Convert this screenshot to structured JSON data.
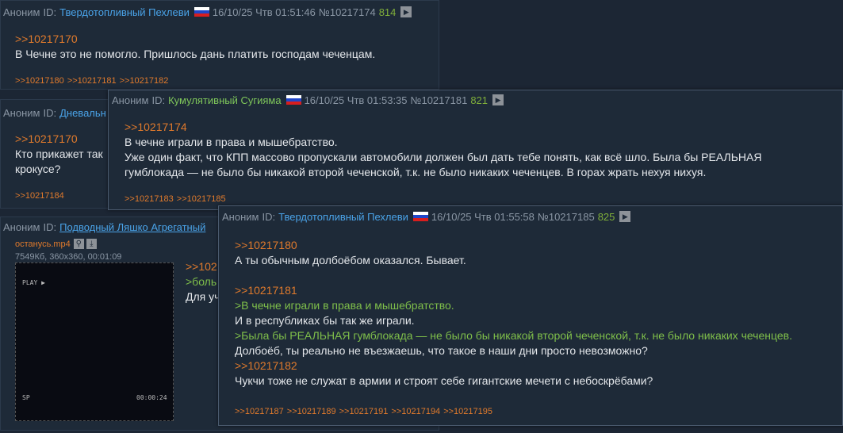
{
  "post1": {
    "name": "Аноним",
    "id_label": "ID:",
    "poster_id": "Твердотопливный Пехлеви",
    "date": "16/10/25 Чтв 01:51:46",
    "num": "№10217174",
    "reply_count": "814",
    "ref": ">>10217170",
    "text": "В Чечне это не помогло. Пришлось дань платить господам чеченцам.",
    "replies": [
      ">>10217180",
      ">>10217181",
      ">>10217182"
    ]
  },
  "post2": {
    "name": "Аноним",
    "id_label": "ID:",
    "poster_id": "Дневальн",
    "ref": ">>10217170",
    "line1": "Кто прикажет так",
    "line2": "крокусе?",
    "replies": [
      ">>10217184"
    ]
  },
  "post3": {
    "name": "Аноним",
    "id_label": "ID:",
    "poster_id": "Подводный Ляшко Агрегатный",
    "file_name": "останусь.mp4",
    "file_meta": "7549Кб, 360x360, 00:01:09",
    "video_play": "PLAY ▶",
    "video_sp": "SP",
    "video_time": "00:00:24",
    "ref": ">>102",
    "green": ">боль",
    "line": "Для уч"
  },
  "popup1": {
    "name": "Аноним",
    "id_label": "ID:",
    "poster_id": "Кумулятивный Сугияма",
    "date": "16/10/25 Чтв 01:53:35",
    "num": "№10217181",
    "reply_count": "821",
    "ref": ">>10217174",
    "line1": "В чечне играли в права и мышебратство.",
    "line2": "Уже один факт, что КПП массово пропускали автомобили должен был дать тебе понять, как всё шло. Была бы РЕАЛЬНАЯ",
    "line3": "гумблокада — не было бы никакой второй чеченской, т.к. не было никаких чеченцев. В горах жрать нехуя нихуя.",
    "replies": [
      ">>10217183",
      ">>10217185"
    ]
  },
  "popup2": {
    "name": "Аноним",
    "id_label": "ID:",
    "poster_id": "Твердотопливный Пехлеви",
    "date": "16/10/25 Чтв 01:55:58",
    "num": "№10217185",
    "reply_count": "825",
    "ref1": ">>10217180",
    "text1": "А ты обычным долбоёбом оказался. Бывает.",
    "ref2": ">>10217181",
    "green1": ">В чечне играли в права и мышебратство.",
    "text2": "И в республиках бы так же играли.",
    "green2": ">Была бы РЕАЛЬНАЯ гумблокада — не было бы никакой второй чеченской, т.к. не было никаких чеченцев.",
    "text3": "Долбоёб, ты реально не въезжаешь, что такое в наши дни просто невозможно?",
    "ref3": ">>10217182",
    "text4": "Чукчи тоже не служат в армии и строят себе гигантские мечети с небоскрёбами?",
    "replies": [
      ">>10217187",
      ">>10217189",
      ">>10217191",
      ">>10217194",
      ">>10217195"
    ]
  },
  "colors": {
    "flag_white": "#ffffff",
    "flag_blue": "#2046c8",
    "flag_red": "#d81e1e"
  }
}
